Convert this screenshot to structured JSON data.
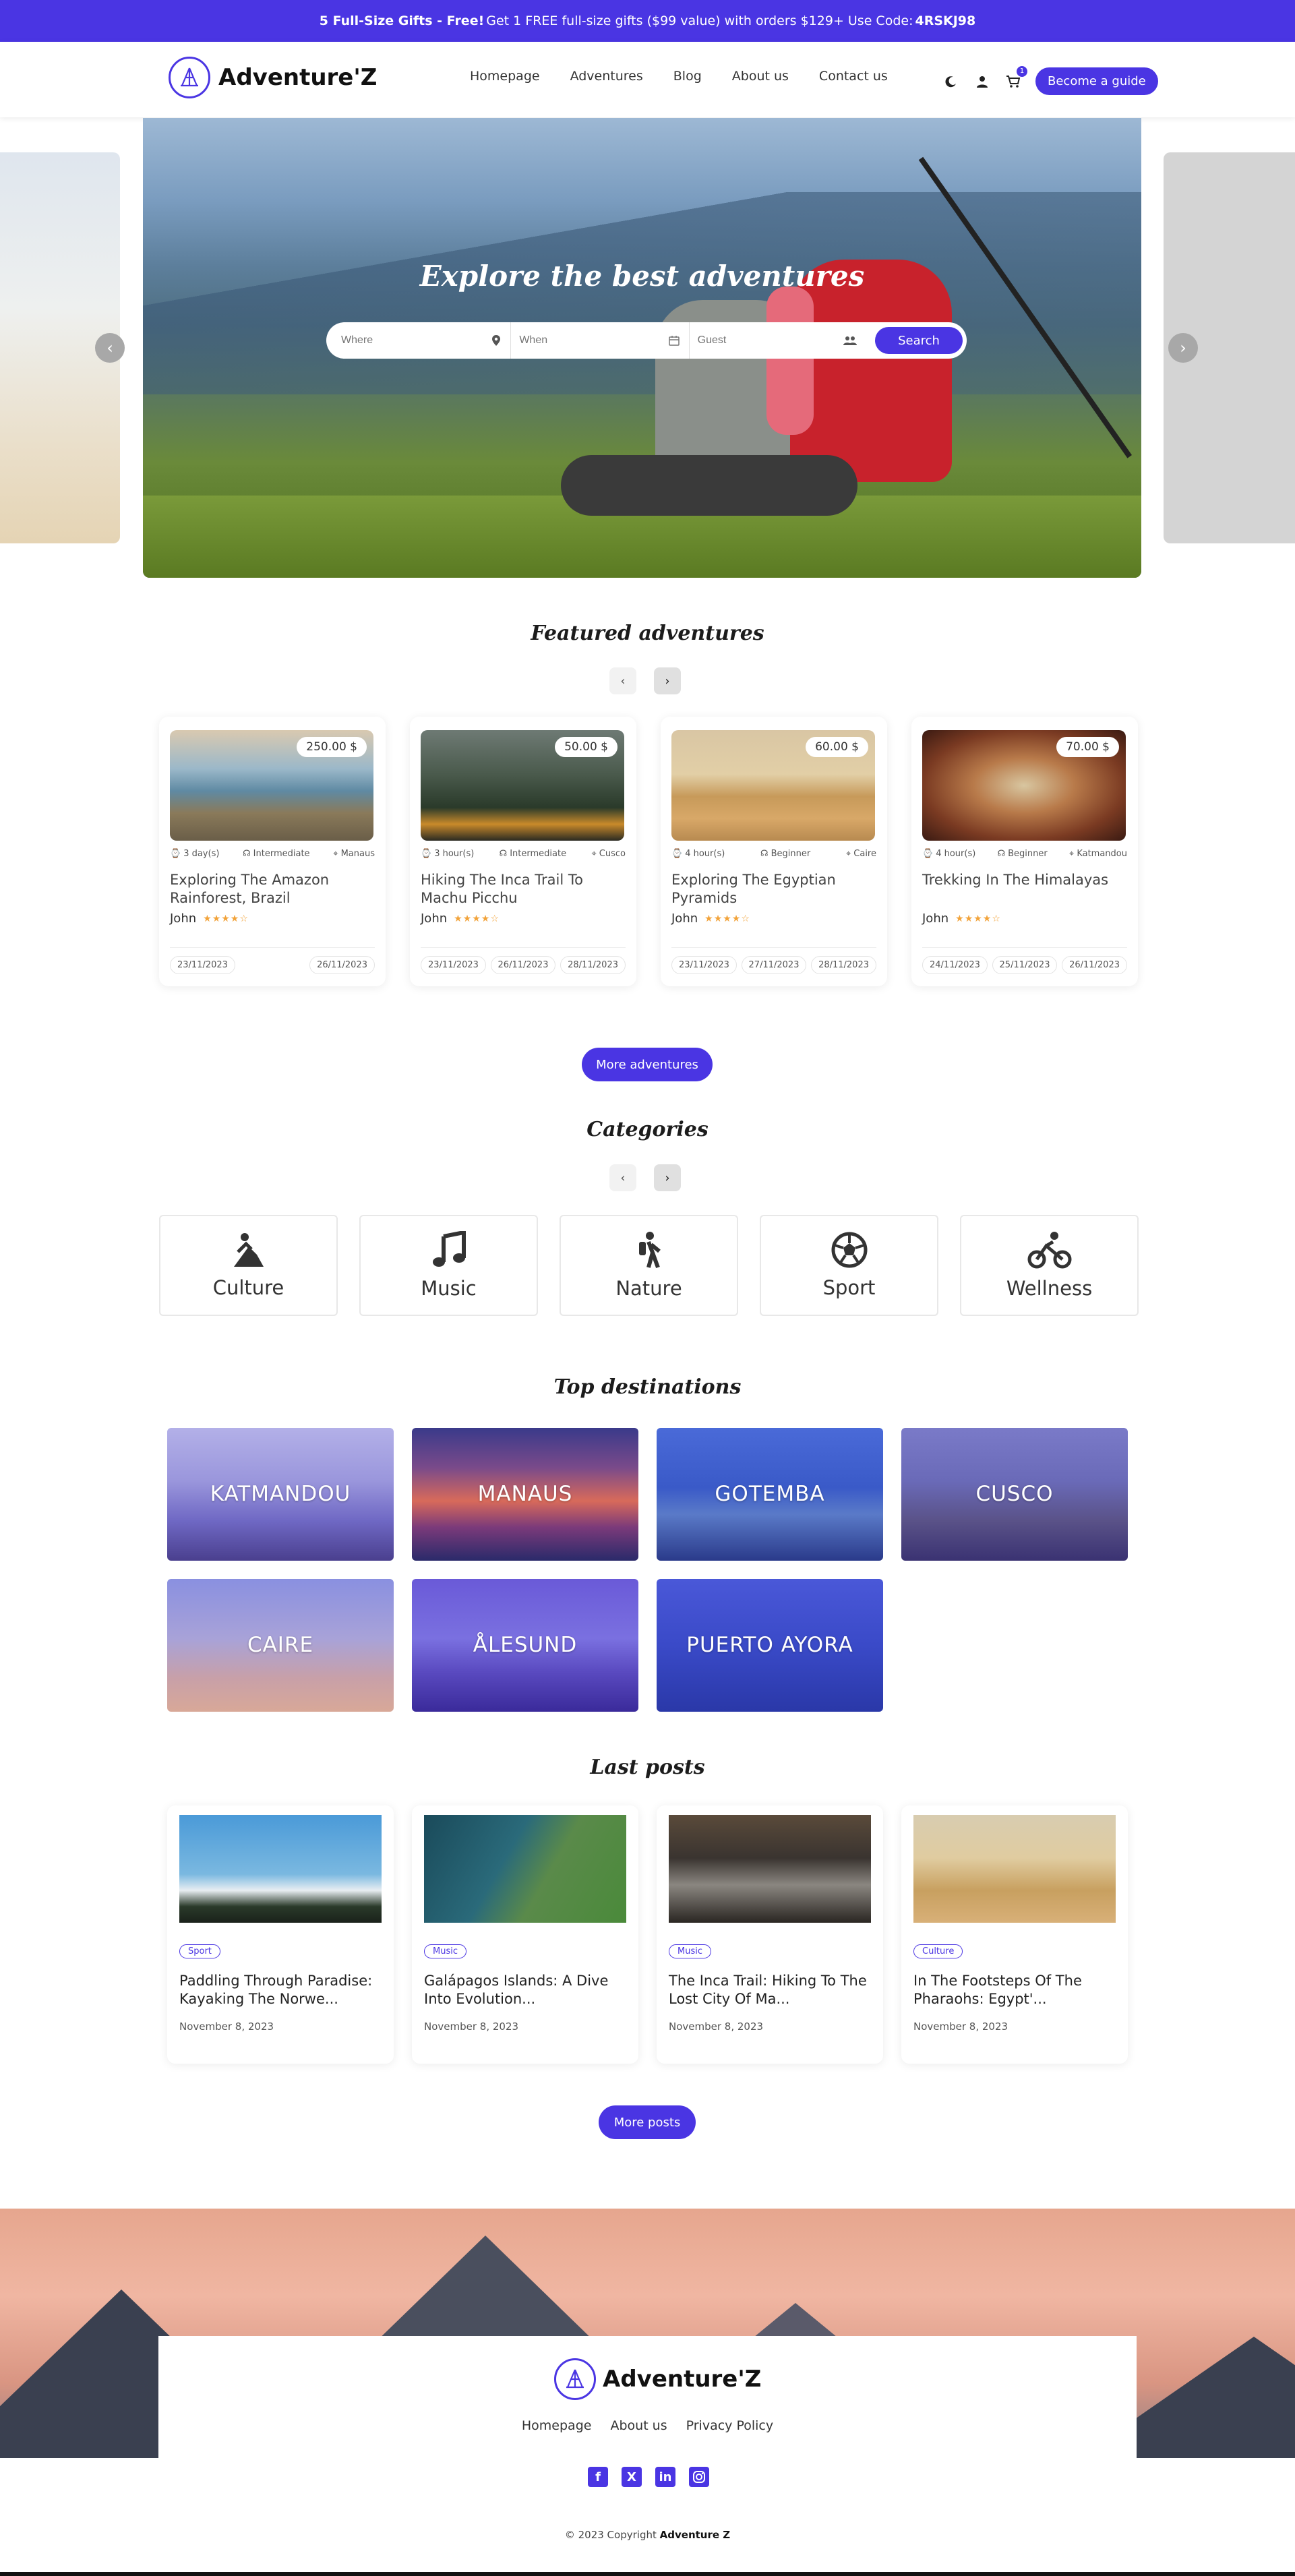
{
  "promo": {
    "bold": "5 Full-Size Gifts - Free!",
    "text": "Get 1 FREE full-size gifts ($99 value) with orders $129+ Use Code:",
    "code": "4RSKJ98"
  },
  "header": {
    "logo": "Adventure'Z",
    "nav": [
      "Homepage",
      "Adventures",
      "Blog",
      "About us",
      "Contact us"
    ],
    "cart_count": "1",
    "guide_button": "Become a guide"
  },
  "hero": {
    "title": "Explore the best adventures",
    "where_placeholder": "Where",
    "when_placeholder": "When",
    "guest_placeholder": "Guest",
    "search_button": "Search"
  },
  "featured": {
    "title": "Featured adventures",
    "cards": [
      {
        "price": "250.00 $",
        "duration": "3 day(s)",
        "level": "Intermediate",
        "location": "Manaus",
        "title": "Exploring The Amazon Rainforest, Brazil",
        "user": "John",
        "rating": 4,
        "dates": [
          "23/11/2023",
          "26/11/2023"
        ]
      },
      {
        "price": "50.00 $",
        "duration": "3 hour(s)",
        "level": "Intermediate",
        "location": "Cusco",
        "title": "Hiking The Inca Trail To Machu Picchu",
        "user": "John",
        "rating": 4,
        "dates": [
          "23/11/2023",
          "26/11/2023",
          "28/11/2023"
        ]
      },
      {
        "price": "60.00 $",
        "duration": "4 hour(s)",
        "level": "Beginner",
        "location": "Caire",
        "title": "Exploring The Egyptian Pyramids",
        "user": "John",
        "rating": 4,
        "dates": [
          "23/11/2023",
          "27/11/2023",
          "28/11/2023"
        ]
      },
      {
        "price": "70.00 $",
        "duration": "4 hour(s)",
        "level": "Beginner",
        "location": "Katmandou",
        "title": "Trekking In The Himalayas",
        "user": "John",
        "rating": 4,
        "dates": [
          "24/11/2023",
          "25/11/2023",
          "26/11/2023"
        ]
      }
    ],
    "more_button": "More adventures"
  },
  "categories": {
    "title": "Categories",
    "items": [
      "Culture",
      "Music",
      "Nature",
      "Sport",
      "Wellness"
    ]
  },
  "destinations": {
    "title": "Top destinations",
    "items": [
      "KATMANDOU",
      "MANAUS",
      "GOTEMBA",
      "CUSCO",
      "CAIRE",
      "ÅLESUND",
      "PUERTO AYORA"
    ]
  },
  "posts": {
    "title": "Last posts",
    "items": [
      {
        "tag": "Sport",
        "title": "Paddling Through Paradise: Kayaking The Norwe...",
        "date": "November 8, 2023"
      },
      {
        "tag": "Music",
        "title": "Galápagos Islands: A Dive Into Evolution...",
        "date": "November 8, 2023"
      },
      {
        "tag": "Music",
        "title": "The Inca Trail: Hiking To The Lost City Of Ma...",
        "date": "November 8, 2023"
      },
      {
        "tag": "Culture",
        "title": "In The Footsteps Of The Pharaohs: Egypt'...",
        "date": "November 8, 2023"
      }
    ],
    "more_button": "More posts"
  },
  "footer": {
    "logo": "Adventure'Z",
    "links": [
      "Homepage",
      "About us",
      "Privacy Policy"
    ],
    "socials": [
      "facebook-icon",
      "x-icon",
      "linkedin-icon",
      "instagram-icon"
    ],
    "copyright_prefix": "© 2023 Copyright",
    "copyright_brand": "Adventure Z"
  },
  "colors": {
    "accent": "#4a35e3",
    "star": "#f2a33a"
  }
}
